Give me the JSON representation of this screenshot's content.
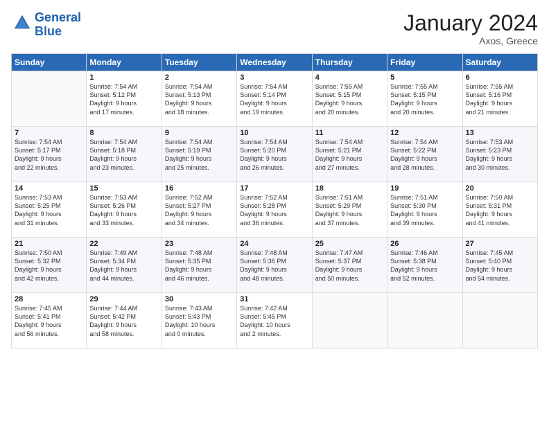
{
  "header": {
    "logo_line1": "General",
    "logo_line2": "Blue",
    "month_title": "January 2024",
    "location": "Axos, Greece"
  },
  "columns": [
    "Sunday",
    "Monday",
    "Tuesday",
    "Wednesday",
    "Thursday",
    "Friday",
    "Saturday"
  ],
  "weeks": [
    [
      {
        "day": "",
        "info": ""
      },
      {
        "day": "1",
        "info": "Sunrise: 7:54 AM\nSunset: 5:12 PM\nDaylight: 9 hours\nand 17 minutes."
      },
      {
        "day": "2",
        "info": "Sunrise: 7:54 AM\nSunset: 5:13 PM\nDaylight: 9 hours\nand 18 minutes."
      },
      {
        "day": "3",
        "info": "Sunrise: 7:54 AM\nSunset: 5:14 PM\nDaylight: 9 hours\nand 19 minutes."
      },
      {
        "day": "4",
        "info": "Sunrise: 7:55 AM\nSunset: 5:15 PM\nDaylight: 9 hours\nand 20 minutes."
      },
      {
        "day": "5",
        "info": "Sunrise: 7:55 AM\nSunset: 5:15 PM\nDaylight: 9 hours\nand 20 minutes."
      },
      {
        "day": "6",
        "info": "Sunrise: 7:55 AM\nSunset: 5:16 PM\nDaylight: 9 hours\nand 21 minutes."
      }
    ],
    [
      {
        "day": "7",
        "info": "Sunrise: 7:54 AM\nSunset: 5:17 PM\nDaylight: 9 hours\nand 22 minutes."
      },
      {
        "day": "8",
        "info": "Sunrise: 7:54 AM\nSunset: 5:18 PM\nDaylight: 9 hours\nand 23 minutes."
      },
      {
        "day": "9",
        "info": "Sunrise: 7:54 AM\nSunset: 5:19 PM\nDaylight: 9 hours\nand 25 minutes."
      },
      {
        "day": "10",
        "info": "Sunrise: 7:54 AM\nSunset: 5:20 PM\nDaylight: 9 hours\nand 26 minutes."
      },
      {
        "day": "11",
        "info": "Sunrise: 7:54 AM\nSunset: 5:21 PM\nDaylight: 9 hours\nand 27 minutes."
      },
      {
        "day": "12",
        "info": "Sunrise: 7:54 AM\nSunset: 5:22 PM\nDaylight: 9 hours\nand 28 minutes."
      },
      {
        "day": "13",
        "info": "Sunrise: 7:53 AM\nSunset: 5:23 PM\nDaylight: 9 hours\nand 30 minutes."
      }
    ],
    [
      {
        "day": "14",
        "info": "Sunrise: 7:53 AM\nSunset: 5:25 PM\nDaylight: 9 hours\nand 31 minutes."
      },
      {
        "day": "15",
        "info": "Sunrise: 7:53 AM\nSunset: 5:26 PM\nDaylight: 9 hours\nand 33 minutes."
      },
      {
        "day": "16",
        "info": "Sunrise: 7:52 AM\nSunset: 5:27 PM\nDaylight: 9 hours\nand 34 minutes."
      },
      {
        "day": "17",
        "info": "Sunrise: 7:52 AM\nSunset: 5:28 PM\nDaylight: 9 hours\nand 36 minutes."
      },
      {
        "day": "18",
        "info": "Sunrise: 7:51 AM\nSunset: 5:29 PM\nDaylight: 9 hours\nand 37 minutes."
      },
      {
        "day": "19",
        "info": "Sunrise: 7:51 AM\nSunset: 5:30 PM\nDaylight: 9 hours\nand 39 minutes."
      },
      {
        "day": "20",
        "info": "Sunrise: 7:50 AM\nSunset: 5:31 PM\nDaylight: 9 hours\nand 41 minutes."
      }
    ],
    [
      {
        "day": "21",
        "info": "Sunrise: 7:50 AM\nSunset: 5:32 PM\nDaylight: 9 hours\nand 42 minutes."
      },
      {
        "day": "22",
        "info": "Sunrise: 7:49 AM\nSunset: 5:34 PM\nDaylight: 9 hours\nand 44 minutes."
      },
      {
        "day": "23",
        "info": "Sunrise: 7:48 AM\nSunset: 5:35 PM\nDaylight: 9 hours\nand 46 minutes."
      },
      {
        "day": "24",
        "info": "Sunrise: 7:48 AM\nSunset: 5:36 PM\nDaylight: 9 hours\nand 48 minutes."
      },
      {
        "day": "25",
        "info": "Sunrise: 7:47 AM\nSunset: 5:37 PM\nDaylight: 9 hours\nand 50 minutes."
      },
      {
        "day": "26",
        "info": "Sunrise: 7:46 AM\nSunset: 5:38 PM\nDaylight: 9 hours\nand 52 minutes."
      },
      {
        "day": "27",
        "info": "Sunrise: 7:45 AM\nSunset: 5:40 PM\nDaylight: 9 hours\nand 54 minutes."
      }
    ],
    [
      {
        "day": "28",
        "info": "Sunrise: 7:45 AM\nSunset: 5:41 PM\nDaylight: 9 hours\nand 56 minutes."
      },
      {
        "day": "29",
        "info": "Sunrise: 7:44 AM\nSunset: 5:42 PM\nDaylight: 9 hours\nand 58 minutes."
      },
      {
        "day": "30",
        "info": "Sunrise: 7:43 AM\nSunset: 5:43 PM\nDaylight: 10 hours\nand 0 minutes."
      },
      {
        "day": "31",
        "info": "Sunrise: 7:42 AM\nSunset: 5:45 PM\nDaylight: 10 hours\nand 2 minutes."
      },
      {
        "day": "",
        "info": ""
      },
      {
        "day": "",
        "info": ""
      },
      {
        "day": "",
        "info": ""
      }
    ]
  ]
}
